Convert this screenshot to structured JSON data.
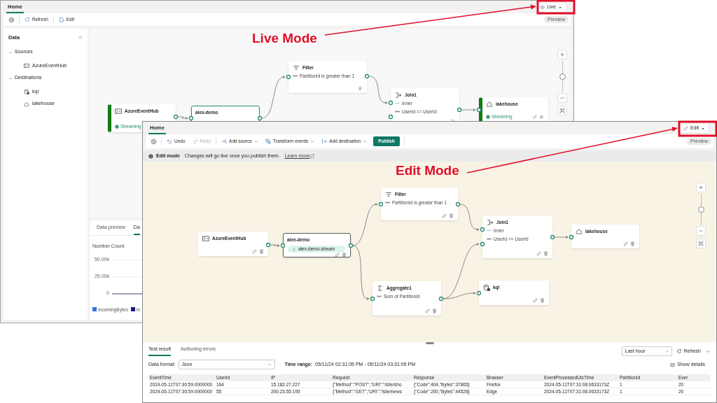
{
  "live_window": {
    "tabs": [
      {
        "label": "Home",
        "selected": true
      }
    ],
    "mode_button": {
      "label": "Live"
    },
    "toolbar": [
      {
        "kind": "settings"
      },
      {
        "kind": "refresh",
        "label": "Refresh"
      },
      {
        "kind": "edit",
        "label": "Edit"
      }
    ],
    "preview_badge": "Preview",
    "sidebar": {
      "title": "Data",
      "sections": [
        {
          "label": "Sources",
          "expanded": true,
          "children": [
            {
              "label": "AzureEventHub",
              "kind": "source"
            }
          ]
        },
        {
          "label": "Destinations",
          "expanded": true,
          "children": [
            {
              "label": "kql",
              "kind": "kql"
            },
            {
              "label": "lakehouse",
              "kind": "lakehouse"
            }
          ]
        }
      ]
    },
    "nodes": [
      {
        "kind": "source",
        "title": "AzureEventHub",
        "status": "Streaming",
        "selected": false
      },
      {
        "kind": "stream",
        "title": "alex-demo",
        "selected": true
      },
      {
        "kind": "filter",
        "title": "Filter",
        "lines": [
          {
            "kind": "field",
            "text": "PartitionId is greater than 1"
          }
        ],
        "selected": false
      },
      {
        "kind": "join",
        "title": "Join1",
        "lines": [
          {
            "kind": "join-type",
            "text": "Inner"
          },
          {
            "kind": "field",
            "text": "UserId == UserId"
          }
        ],
        "selected": false
      },
      {
        "kind": "lakehouse",
        "title": "lakehouse",
        "status": "Streaming",
        "selected": false
      }
    ],
    "zoom_slider": {
      "level": 0.5
    },
    "bottom_tabs": [
      {
        "label": "Data preview",
        "selected": false
      },
      {
        "label": "Da",
        "selected": true
      }
    ],
    "chart": {
      "title": "Number Count",
      "y_labels": [
        "50.00k",
        "25.00k",
        "0"
      ],
      "legend": [
        {
          "label": "IncomingBytes",
          "color": "#2f74d9"
        },
        {
          "label": "In",
          "color": "#1e1b8f"
        }
      ]
    }
  },
  "annotations": [
    {
      "label": "Live Mode"
    },
    {
      "label": "Edit Mode"
    }
  ],
  "edit_window": {
    "tabs": [
      {
        "label": "Home",
        "selected": true
      }
    ],
    "mode_button": {
      "label": "Edit"
    },
    "toolbar": [
      {
        "kind": "settings"
      },
      {
        "kind": "undo",
        "label": "Undo",
        "disabled": false
      },
      {
        "kind": "redo",
        "label": "Redo",
        "disabled": true
      },
      {
        "kind": "add-source",
        "label": "Add source"
      },
      {
        "kind": "transform",
        "label": "Transform events"
      },
      {
        "kind": "add-destination",
        "label": "Add destination"
      },
      {
        "kind": "publish",
        "label": "Publish"
      }
    ],
    "preview_badge": "Preview",
    "notice": {
      "title": "Edit mode",
      "text": "Changes will go live once you publish them.",
      "link": "Learn more"
    },
    "nodes": [
      {
        "kind": "source",
        "title": "AzureEventHub",
        "selected": false
      },
      {
        "kind": "stream",
        "title": "alex-demo",
        "pill": "alex-demo-stream",
        "selected": true
      },
      {
        "kind": "filter",
        "title": "Filter",
        "lines": [
          {
            "kind": "field",
            "text": "PartitionId is greater than 1"
          }
        ],
        "selected": false
      },
      {
        "kind": "join",
        "title": "Join1",
        "lines": [
          {
            "kind": "join-type",
            "text": "Inner"
          },
          {
            "kind": "field",
            "text": "UserId == UserId"
          }
        ],
        "selected": false
      },
      {
        "kind": "lakehouse",
        "title": "lakehouse",
        "selected": false
      },
      {
        "kind": "aggregate",
        "title": "Aggregate1",
        "lines": [
          {
            "kind": "field",
            "text": "Sum of PartitionId"
          }
        ],
        "selected": false
      },
      {
        "kind": "kql",
        "title": "kql",
        "selected": false
      }
    ],
    "zoom_slider": {
      "level": 0.5
    },
    "results": {
      "tabs": [
        {
          "label": "Test result",
          "selected": true
        },
        {
          "label": "Authoring errors",
          "selected": false
        }
      ],
      "range_select": "Last hour",
      "refresh": "Refresh",
      "format_label": "Data format:",
      "format_value": "Json",
      "time_label": "Time range:",
      "time_value": "05/11/24 02:31:05 PM - 05/11/24 03:31:05 PM",
      "details": "Show details",
      "table": {
        "columns": [
          "EventTime",
          "UserId",
          "IP",
          "Request",
          "Response",
          "Browser",
          "EventProcessedUtcTime",
          "PartitionId",
          "Ever"
        ],
        "rows": [
          [
            "2024-05-11T07:30:59.0000000",
            "164",
            "15.182.27.227",
            "{\"Method\":\"POST\",\"URI\":\"/site/sho",
            "{\"Code\":404,\"Bytes\":37865}",
            "Firefox",
            "2024-05-11T07:31:08.0633173Z",
            "1",
            "20"
          ],
          [
            "2024-05-11T07:30:59.0000000",
            "55",
            "200.23.55.195",
            "{\"Method\":\"GET\",\"URI\":\"/site/news",
            "{\"Code\":200,\"Bytes\":44528}",
            "Edge",
            "2024-05-11T07:31:08.0633173Z",
            "1",
            "20"
          ]
        ]
      }
    }
  }
}
